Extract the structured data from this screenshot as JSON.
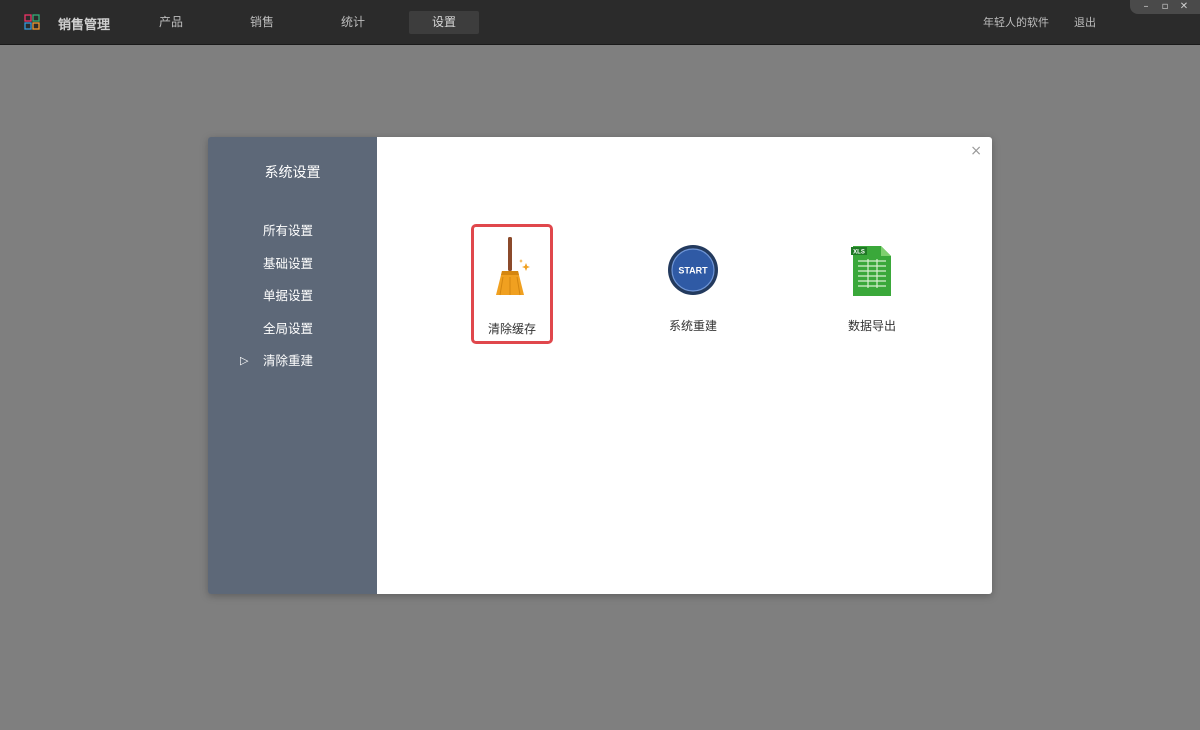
{
  "topbar": {
    "app_title": "销售管理",
    "tabs": [
      {
        "label": "产品"
      },
      {
        "label": "销售"
      },
      {
        "label": "统计"
      },
      {
        "label": "设置",
        "active": true
      }
    ],
    "user_label": "年轻人的软件",
    "logout_label": "退出",
    "window_controls": [
      "minimize-icon",
      "maximize-icon",
      "close-icon"
    ]
  },
  "dialog": {
    "sidebar_title": "系统设置",
    "sidebar_items": [
      {
        "label": "所有设置"
      },
      {
        "label": "基础设置"
      },
      {
        "label": "单据设置"
      },
      {
        "label": "全局设置"
      },
      {
        "label": "清除重建",
        "active": true
      }
    ],
    "close_label": "×",
    "tiles": [
      {
        "label": "清除缓存",
        "icon": "broom-icon",
        "selected": true
      },
      {
        "label": "系统重建",
        "icon": "start-icon",
        "icon_text": "START"
      },
      {
        "label": "数据导出",
        "icon": "xls-file-icon",
        "icon_text": "XLS"
      }
    ]
  },
  "colors": {
    "overlay": "#7f7f7f",
    "topbar": "#2b2b2b",
    "sidebar": "#5d6878",
    "highlight": "#e0474c",
    "xls_green": "#3aa83a",
    "start_blue": "#2f5aa5",
    "broom_orange": "#f0a020"
  }
}
